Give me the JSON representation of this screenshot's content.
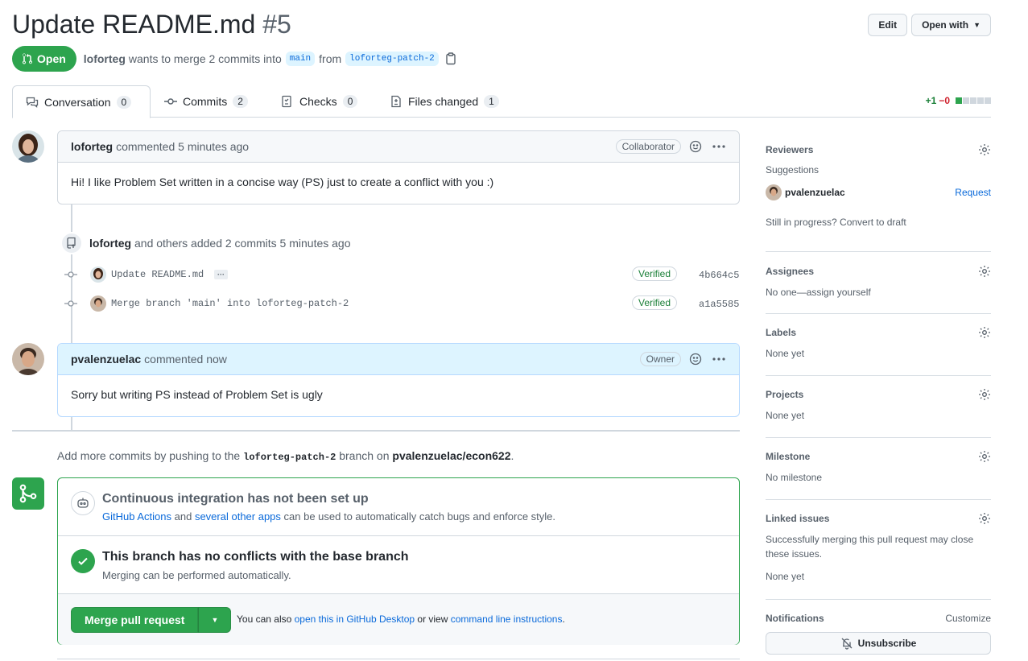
{
  "header": {
    "title": "Update README.md",
    "number": "#5",
    "edit_label": "Edit",
    "open_with_label": "Open with"
  },
  "meta": {
    "state": "Open",
    "author": "loforteg",
    "text_before": "wants to merge 2 commits into",
    "base_branch": "main",
    "text_from": "from",
    "head_branch": "loforteg-patch-2"
  },
  "tabs": [
    {
      "label": "Conversation",
      "count": "0"
    },
    {
      "label": "Commits",
      "count": "2"
    },
    {
      "label": "Checks",
      "count": "0"
    },
    {
      "label": "Files changed",
      "count": "1"
    }
  ],
  "diffstat": {
    "additions": "+1",
    "deletions": "−0"
  },
  "comment1": {
    "author": "loforteg",
    "action": "commented 5 minutes ago",
    "role": "Collaborator",
    "body": "Hi! I like Problem Set written in a concise way (PS) just to create a conflict with you :)"
  },
  "commits_event": {
    "author": "loforteg",
    "text": "and others added 2 commits 5 minutes ago",
    "commits": [
      {
        "message": "Update README.md",
        "verified": "Verified",
        "sha": "4b664c5",
        "ellipsis": "···"
      },
      {
        "message": "Merge branch 'main' into loforteg-patch-2",
        "verified": "Verified",
        "sha": "a1a5585"
      }
    ]
  },
  "comment2": {
    "author": "pvalenzuelac",
    "action": "commented now",
    "role": "Owner",
    "body": "Sorry but writing PS instead of Problem Set is ugly"
  },
  "push_hint": {
    "before": "Add more commits by pushing to the",
    "branch": "loforteg-patch-2",
    "middle": "branch on",
    "repo": "pvalenzuelac/econ622",
    "end": "."
  },
  "ci": {
    "title": "Continuous integration has not been set up",
    "link1": "GitHub Actions",
    "mid": "and",
    "link2": "several other apps",
    "rest": "can be used to automatically catch bugs and enforce style."
  },
  "conflicts": {
    "title": "This branch has no conflicts with the base branch",
    "subtitle": "Merging can be performed automatically."
  },
  "merge": {
    "button": "Merge pull request",
    "also": "You can also",
    "link1": "open this in GitHub Desktop",
    "or": "or view",
    "link2": "command line instructions",
    "end": "."
  },
  "sidebar": {
    "reviewers": {
      "title": "Reviewers",
      "suggestions": "Suggestions",
      "user": "pvalenzuelac",
      "request": "Request",
      "draft": "Still in progress? Convert to draft"
    },
    "assignees": {
      "title": "Assignees",
      "value": "No one—assign yourself"
    },
    "labels": {
      "title": "Labels",
      "value": "None yet"
    },
    "projects": {
      "title": "Projects",
      "value": "None yet"
    },
    "milestone": {
      "title": "Milestone",
      "value": "No milestone"
    },
    "linked": {
      "title": "Linked issues",
      "desc": "Successfully merging this pull request may close these issues.",
      "value": "None yet"
    },
    "notifications": {
      "title": "Notifications",
      "customize": "Customize",
      "unsubscribe": "Unsubscribe"
    }
  },
  "colors": {
    "accent": "#2da44e",
    "link": "#0969da"
  }
}
